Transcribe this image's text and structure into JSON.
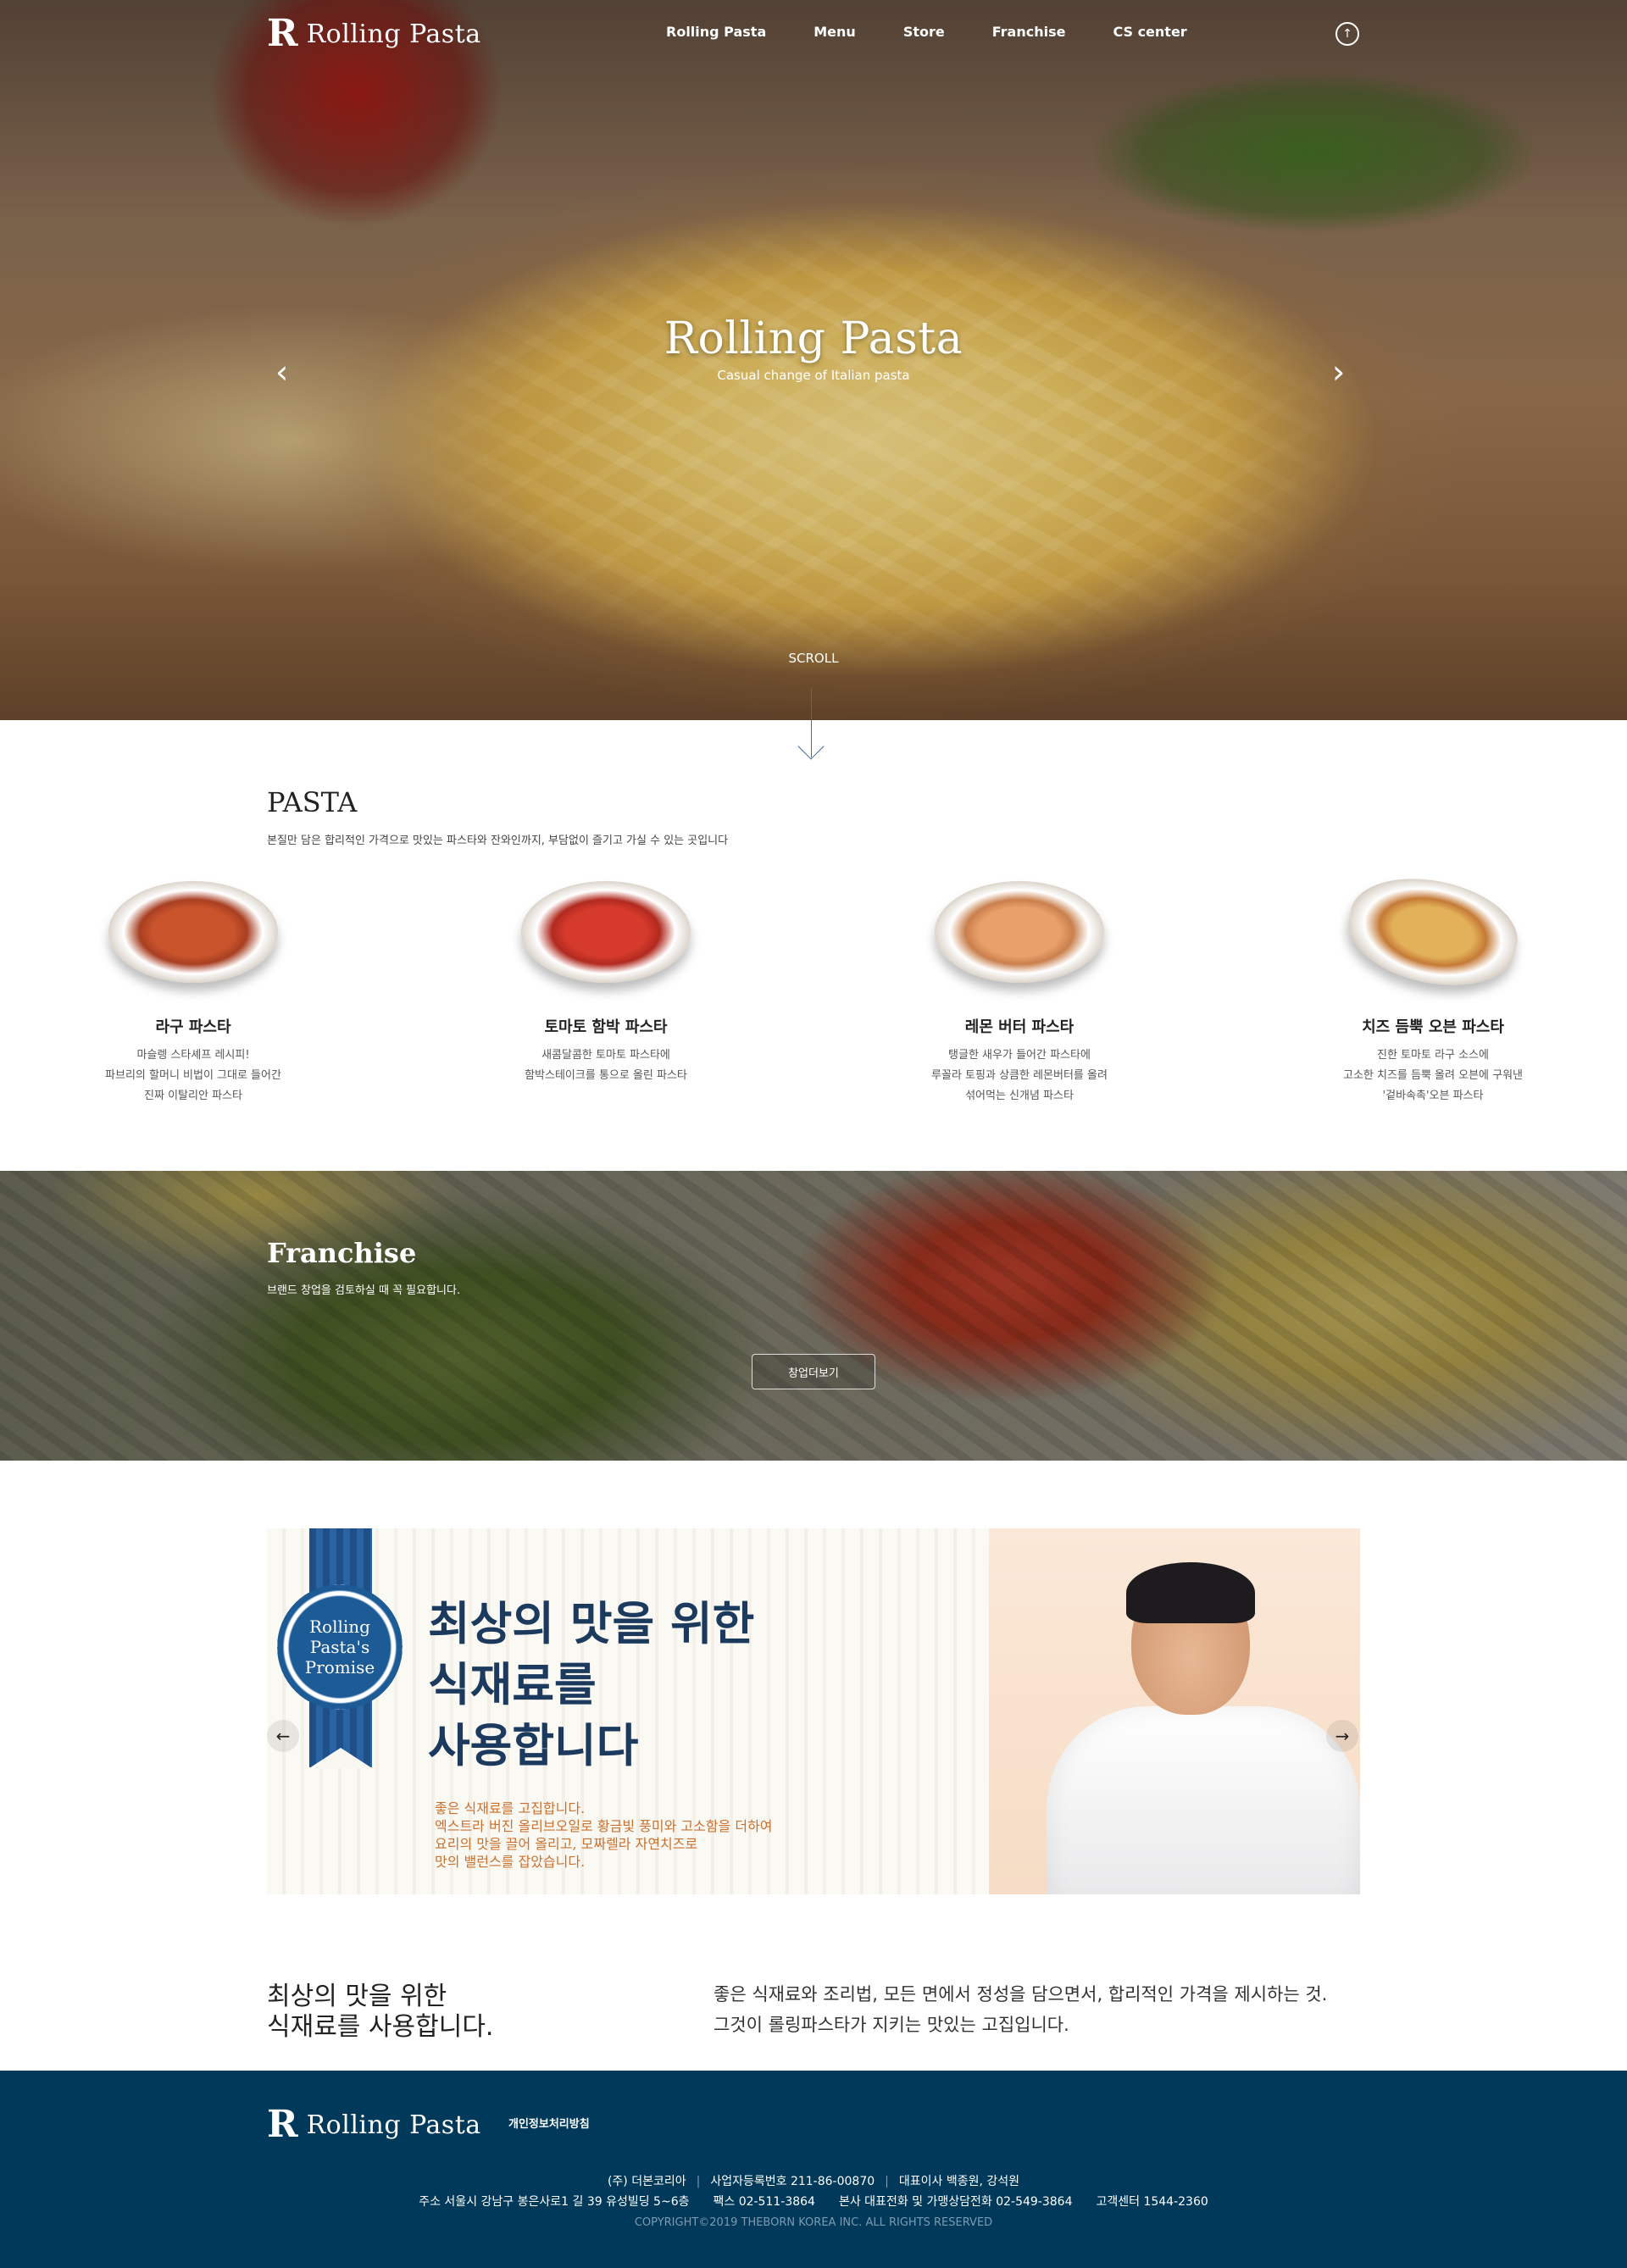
{
  "brand": {
    "name": "Rolling Pasta",
    "mark": "R"
  },
  "nav": {
    "items": [
      "Rolling Pasta",
      "Menu",
      "Store",
      "Franchise",
      "CS center"
    ]
  },
  "hero": {
    "title": "Rolling Pasta",
    "subtitle": "Casual change of Italian pasta",
    "scroll_label": "SCROLL"
  },
  "pasta": {
    "title": "PASTA",
    "subtitle": "본질만 담은 합리적인 가격으로 맛있는 파스타와 잔와인까지, 부담없이 즐기고 가실 수 있는 곳입니다",
    "items": [
      {
        "name": "라구 파스타",
        "lines": [
          "마슬렝 스타셰프 레시피!",
          "파브리의 할머니 비법이 그대로 들어간",
          "진짜 이탈리안 파스타"
        ]
      },
      {
        "name": "토마토 함박 파스타",
        "lines": [
          "새콤달콤한 토마토 파스타에",
          "함박스테이크를 통으로 올린 파스타"
        ]
      },
      {
        "name": "레몬 버터 파스타",
        "lines": [
          "탱글한 새우가 들어간 파스타에",
          "루꼴라 토핑과 상큼한 레몬버터를 올려",
          "섞어먹는 신개념 파스타"
        ]
      },
      {
        "name": "치즈 듬뿍 오븐 파스타",
        "lines": [
          "진한 토마토 라구 소스에",
          "고소한 치즈를 듬뿍 올려 오븐에 구워낸",
          "'겉바속촉'오븐 파스타"
        ]
      }
    ]
  },
  "franchise": {
    "title": "Franchise",
    "subtitle": "브랜드 창업을 검토하실 때 꼭 필요합니다.",
    "button_label": "창업더보기"
  },
  "banner": {
    "seal": [
      "Rolling",
      "Pasta's",
      "Promise"
    ],
    "headline": [
      "최상의 맛을 위한",
      "식재료를",
      "사용합니다"
    ],
    "copy": [
      "좋은 식재료를 고집합니다.",
      "엑스트라 버진 올리브오일로 황금빛 풍미와 고소함을 더하여",
      "요리의 맛을 끌어 올리고, 모짜렐라 자연치즈로",
      "맛의 밸런스를 잡았습니다."
    ]
  },
  "promise": {
    "heading": [
      "최상의 맛을 위한",
      "식재료를 사용합니다."
    ],
    "body": [
      "좋은 식재료와 조리법, 모든 면에서 정성을 담으면서, 합리적인 가격을 제시하는 것.",
      "그것이 롤링파스타가 지키는 맛있는 고집입니다."
    ]
  },
  "footer": {
    "privacy": "개인정보처리방침",
    "company": "(주) 더본코리아",
    "biz_no": "사업자등록번호 211-86-00870",
    "ceo": "대표이사 백종원, 강석원",
    "address": "주소 서울시 강남구 봉은사로1 길 39 유성빌딩 5~6층",
    "fax": "팩스 02-511-3864",
    "phone": "본사 대표전화 및 가맹상담전화 02-549-3864",
    "cs": "고객센터 1544-2360",
    "copyright": "COPYRIGHT©2019 THEBORN KOREA INC. ALL RIGHTS RESERVED"
  },
  "colors": {
    "footer_bg": "#003959",
    "accent_blue": "#1d5b96",
    "copy_orange": "#c9712f"
  }
}
